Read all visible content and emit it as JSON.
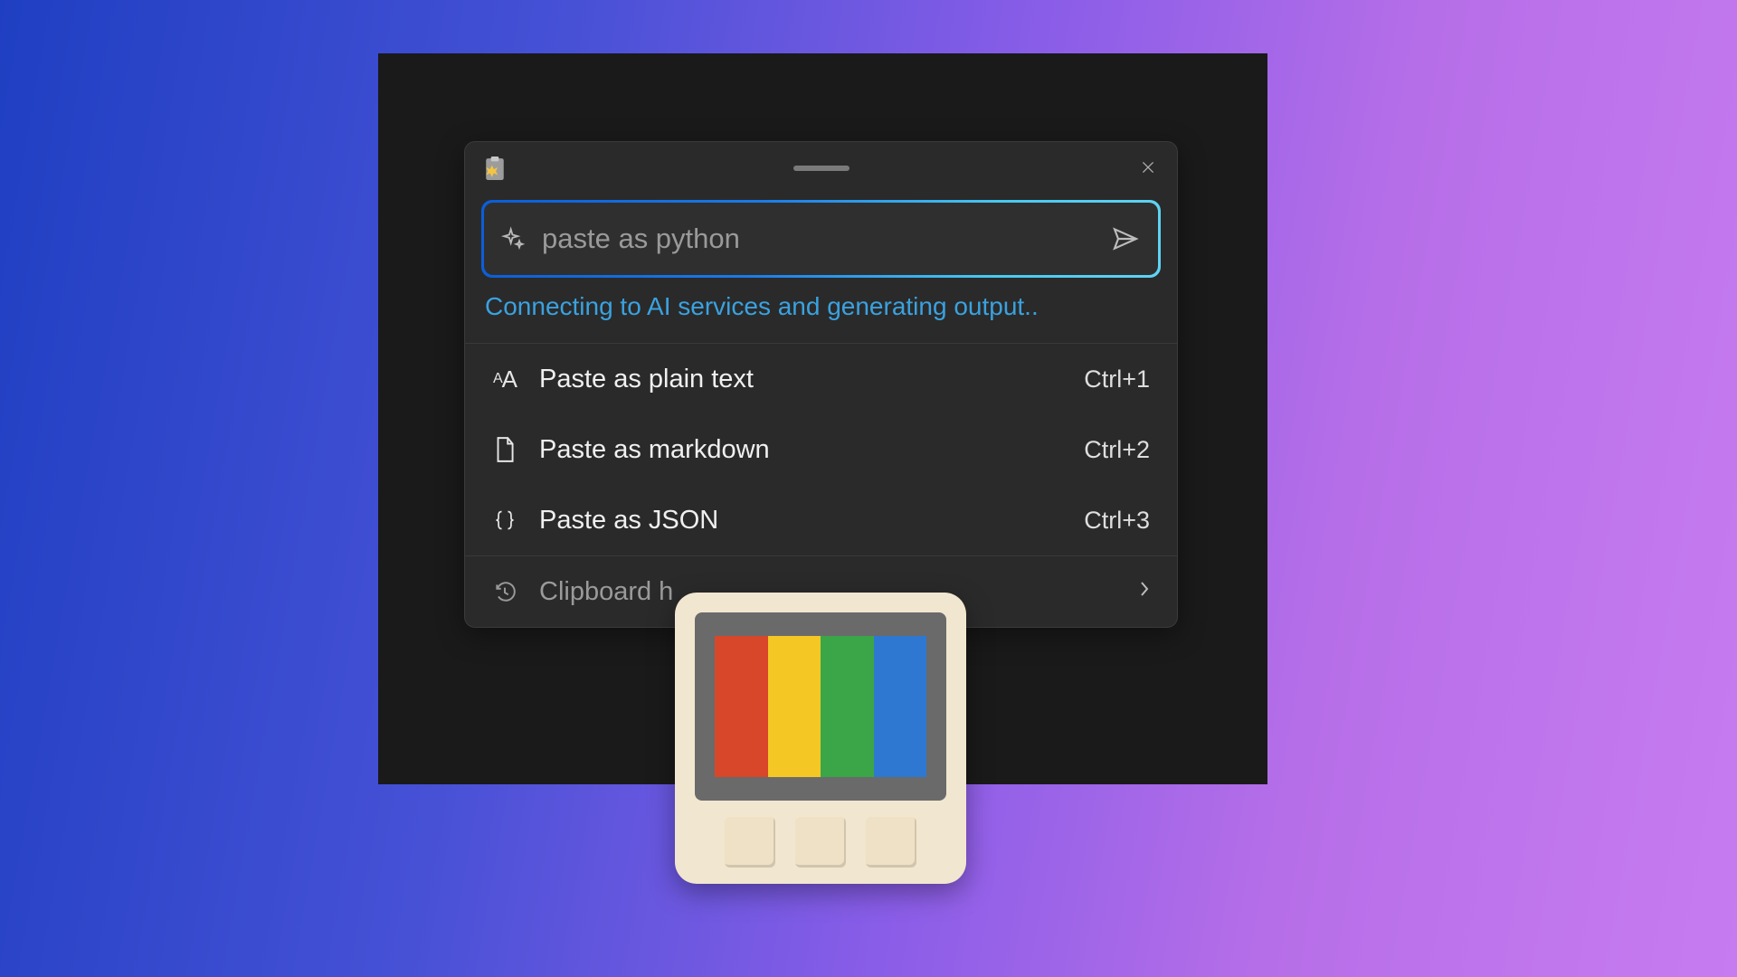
{
  "input": {
    "placeholder": "paste as python"
  },
  "status": "Connecting to AI services and generating output..",
  "options": [
    {
      "icon": "text-size-icon",
      "label": "Paste as plain text",
      "shortcut": "Ctrl+1"
    },
    {
      "icon": "file-icon",
      "label": "Paste as markdown",
      "shortcut": "Ctrl+2"
    },
    {
      "icon": "braces-icon",
      "label": "Paste as JSON",
      "shortcut": "Ctrl+3"
    }
  ],
  "footer": {
    "label": "Clipboard h"
  }
}
